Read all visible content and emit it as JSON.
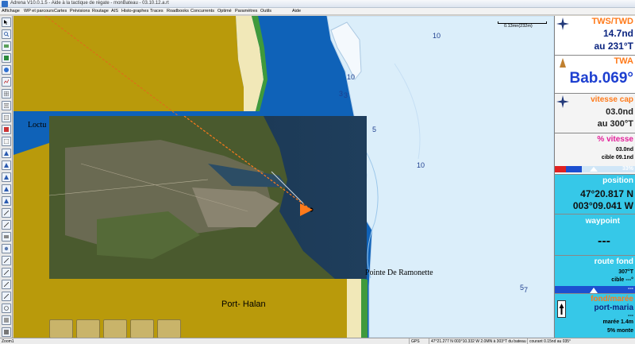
{
  "window": {
    "title": "Adrena V10.0.1.5 - Aide à la tactique de régate - monBateau - 03.10.12.a.rt"
  },
  "menu": [
    {
      "label": "Affichage"
    },
    {
      "label": "WP et parcours"
    },
    {
      "label": "Cartes"
    },
    {
      "label": "Prévisions"
    },
    {
      "label": "Routage"
    },
    {
      "label": "AIS"
    },
    {
      "label": "Histo-graphes"
    },
    {
      "label": "Traces"
    },
    {
      "label": "Roadbooks"
    },
    {
      "label": "Concurrents"
    },
    {
      "label": "Optimé"
    },
    {
      "label": "Paramètres"
    },
    {
      "label": "Outils"
    },
    {
      "label": "Aide"
    }
  ],
  "toolbar": {
    "tools": [
      {
        "icon": "arrow-cursor-icon"
      },
      {
        "icon": "zoom-icon"
      },
      {
        "icon": "waypoint-icon"
      },
      {
        "icon": "chart-icon"
      },
      {
        "icon": "globe-icon"
      },
      {
        "icon": "route-icon"
      },
      {
        "icon": "grid-icon"
      },
      {
        "icon": "layers-icon"
      },
      {
        "icon": "compass-icon"
      },
      {
        "icon": "wind-icon"
      },
      {
        "icon": "boat-icon"
      },
      {
        "icon": "track-icon"
      },
      {
        "icon": "polar-icon"
      },
      {
        "icon": "tide-icon"
      },
      {
        "icon": "ais-icon"
      },
      {
        "icon": "grib-icon"
      },
      {
        "icon": "measure-icon"
      },
      {
        "icon": "camera-icon"
      },
      {
        "icon": "print-icon"
      },
      {
        "icon": "settings-icon"
      },
      {
        "icon": "help-icon"
      },
      {
        "icon": "info-icon"
      },
      {
        "icon": "flag-icon"
      },
      {
        "icon": "anchor-icon"
      },
      {
        "icon": "clock-icon"
      },
      {
        "icon": "log-icon"
      },
      {
        "icon": "exit-icon"
      }
    ]
  },
  "map": {
    "scale_label": "0.13mn(232m)",
    "place_names": {
      "loctu": "Loctu",
      "pointe": "Pointe De Ramonette",
      "port_halan": "Port- Halan"
    },
    "soundings": {
      "d1": "10",
      "d2": "10",
      "d3": "3",
      "d4": "3",
      "d5": "5",
      "d6": "10",
      "d7": "5",
      "d8": "7"
    },
    "colors": {
      "land": "#b99a0b",
      "deep_water": "#0f62b8",
      "shallow_water": "#dbeefa",
      "shore": "#3f9a3c",
      "beach": "#f1e8b8"
    },
    "bottom_buttons": [
      {
        "icon": "sail-config-icon"
      },
      {
        "icon": "tack-icon"
      },
      {
        "icon": "keyboard-icon"
      },
      {
        "icon": "jib-icon"
      },
      {
        "icon": "spinnaker-icon"
      }
    ]
  },
  "panel": {
    "tws": {
      "label": "TWS/TWD",
      "line1": "14.7nd",
      "line2": "au 231°T"
    },
    "twa": {
      "label": "TWA",
      "value": "Bab.069°"
    },
    "vitesse_cap": {
      "label": "vitesse cap",
      "line1": "03.0nd",
      "line2": "au 300°T"
    },
    "pct_vitesse": {
      "label": "% vitesse",
      "line1": "03.0nd",
      "line2": "cible 09.1nd",
      "percent_text": "33%",
      "percent": 33
    },
    "position": {
      "label": "position",
      "lat": "47°20.817 N",
      "lon": "003°09.041 W"
    },
    "waypoint": {
      "label": "waypoint",
      "value": "---"
    },
    "route_fond": {
      "label": "route fond",
      "line1": "307°T",
      "line2": "cible ---°",
      "line3": "---"
    },
    "fond_maree": {
      "label": "fond/marée",
      "place": "port-maria",
      "line1": "---",
      "line2": "marée 1.4m",
      "line3": "5% monte"
    }
  },
  "status": {
    "zoom": "Zoom1",
    "gps": "GPS",
    "position_info": "47°21.277 N  003°10.332 W 2.0MN à 303°T du bateau",
    "current": "courant 0.15nd au 035°"
  }
}
